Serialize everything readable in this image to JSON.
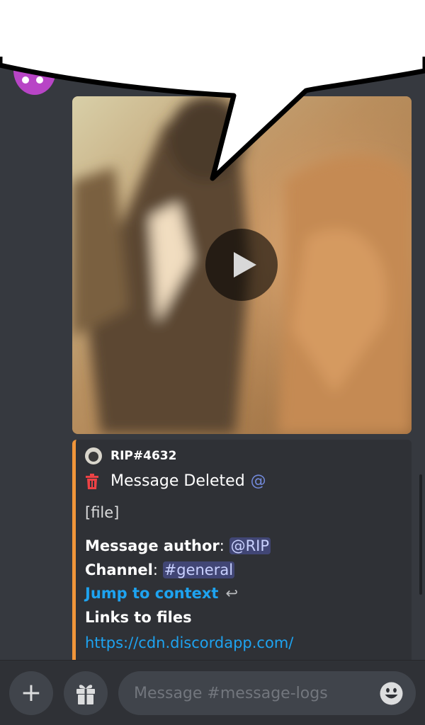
{
  "embed": {
    "author_name": "RIP#4632",
    "title": "Message Deleted",
    "mention_symbol": "@",
    "file_text": "[file]",
    "author_label": "Message author",
    "author_mention": "@RIP",
    "channel_label": "Channel",
    "channel_mention": "#general",
    "jump_label": "Jump to context",
    "links_label": "Links to files",
    "link_url": "https://cdn.discordapp.com/",
    "accent_color": "#f0953a"
  },
  "composer": {
    "placeholder": "Message #message-logs",
    "plus_symbol": "+"
  },
  "icons": {
    "play": "play-icon",
    "trash": "trash-icon",
    "reply": "reply-arrow-icon",
    "gift": "gift-icon",
    "emoji": "smiley-emoji-icon"
  },
  "colors": {
    "background": "#36393f",
    "link": "#1ea3f0",
    "mention_bg": "#414675",
    "delete_red": "#ed4245"
  }
}
